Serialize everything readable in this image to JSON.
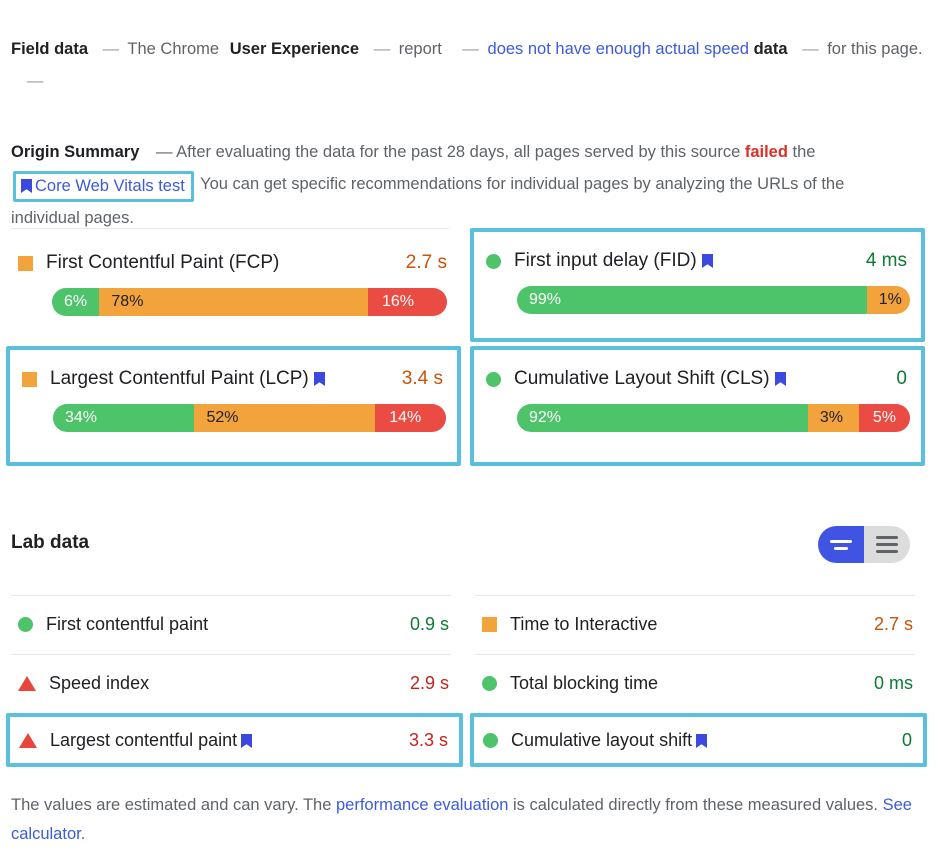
{
  "field_data": {
    "heading": "Field data",
    "dash": "—",
    "parts": {
      "p1": "The Chrome",
      "p2": "User Experience",
      "p3": "report",
      "p4": "does not have enough actual speed",
      "p5": "data",
      "p6": "for this page."
    }
  },
  "origin_summary": {
    "title": "Origin Summary",
    "dash": "—",
    "text1": "After evaluating the data for the past 28 days, all pages served by this source",
    "failed": "failed",
    "the": "the",
    "cwv_link": "Core Web Vitals test",
    "text2": "You can get specific recommendations for individual pages by",
    "text3": "analyzing the URLs of the individual pages."
  },
  "field_metrics": [
    {
      "label": "First Contentful Paint (FCP)",
      "value": "2.7 s",
      "value_color": "orange",
      "shape": "square",
      "bookmark": false,
      "highlighted": false,
      "distribution": [
        {
          "label": "6%",
          "bucket": "good",
          "pct": 6
        },
        {
          "label": "78%",
          "bucket": "avg",
          "pct": 78
        },
        {
          "label": "16%",
          "bucket": "poor",
          "pct": 16
        }
      ]
    },
    {
      "label": "First input delay (FID)",
      "value": "4 ms",
      "value_color": "green",
      "shape": "circle",
      "bookmark": true,
      "highlighted": true,
      "distribution": [
        {
          "label": "99%",
          "bucket": "good",
          "pct": 99
        },
        {
          "label": "1%",
          "bucket": "avg",
          "pct": 1
        }
      ]
    },
    {
      "label": "Largest Contentful Paint (LCP)",
      "value": "3.4 s",
      "value_color": "orange",
      "shape": "square",
      "bookmark": true,
      "highlighted": true,
      "distribution": [
        {
          "label": "34%",
          "bucket": "good",
          "pct": 34
        },
        {
          "label": "52%",
          "bucket": "avg",
          "pct": 52
        },
        {
          "label": "14%",
          "bucket": "poor",
          "pct": 14
        }
      ]
    },
    {
      "label": "Cumulative Layout Shift (CLS)",
      "value": "0",
      "value_color": "green",
      "shape": "circle",
      "bookmark": true,
      "highlighted": true,
      "distribution": [
        {
          "label": "92%",
          "bucket": "good",
          "pct": 92
        },
        {
          "label": "3%",
          "bucket": "avg",
          "pct": 3
        },
        {
          "label": "5%",
          "bucket": "poor",
          "pct": 5
        }
      ]
    }
  ],
  "lab_data": {
    "heading": "Lab data",
    "view_toggle": {
      "active": "list-view",
      "options": [
        "list-view",
        "detail-view"
      ]
    },
    "metrics": [
      {
        "label": "First contentful paint",
        "value": "0.9 s",
        "value_color": "green",
        "shape": "circle",
        "bookmark": false,
        "highlighted": false
      },
      {
        "label": "Time to Interactive",
        "value": "2.7 s",
        "value_color": "orange",
        "shape": "square",
        "bookmark": false,
        "highlighted": false
      },
      {
        "label": "Speed index",
        "value": "2.9 s",
        "value_color": "red",
        "shape": "triangle",
        "bookmark": false,
        "highlighted": false
      },
      {
        "label": "Total blocking time",
        "value": "0 ms",
        "value_color": "green",
        "shape": "circle",
        "bookmark": false,
        "highlighted": false
      },
      {
        "label": "Largest contentful paint",
        "value": "3.3 s",
        "value_color": "red",
        "shape": "triangle",
        "bookmark": true,
        "highlighted": true
      },
      {
        "label": "Cumulative layout shift",
        "value": "0",
        "value_color": "green",
        "shape": "circle",
        "bookmark": true,
        "highlighted": true
      }
    ]
  },
  "footnote": {
    "t1": "The values are estimated and can vary. The ",
    "link1": "performance evaluation",
    "t2": " is calculated directly from these measured values. ",
    "link2": "See calculator."
  },
  "colors": {
    "good": "#4dc36a",
    "average": "#f2a33c",
    "poor": "#ea4b42",
    "highlight": "#5bc0de",
    "link": "#3b5bdb",
    "failed": "#d93025",
    "toggle_active": "#4054e4"
  }
}
